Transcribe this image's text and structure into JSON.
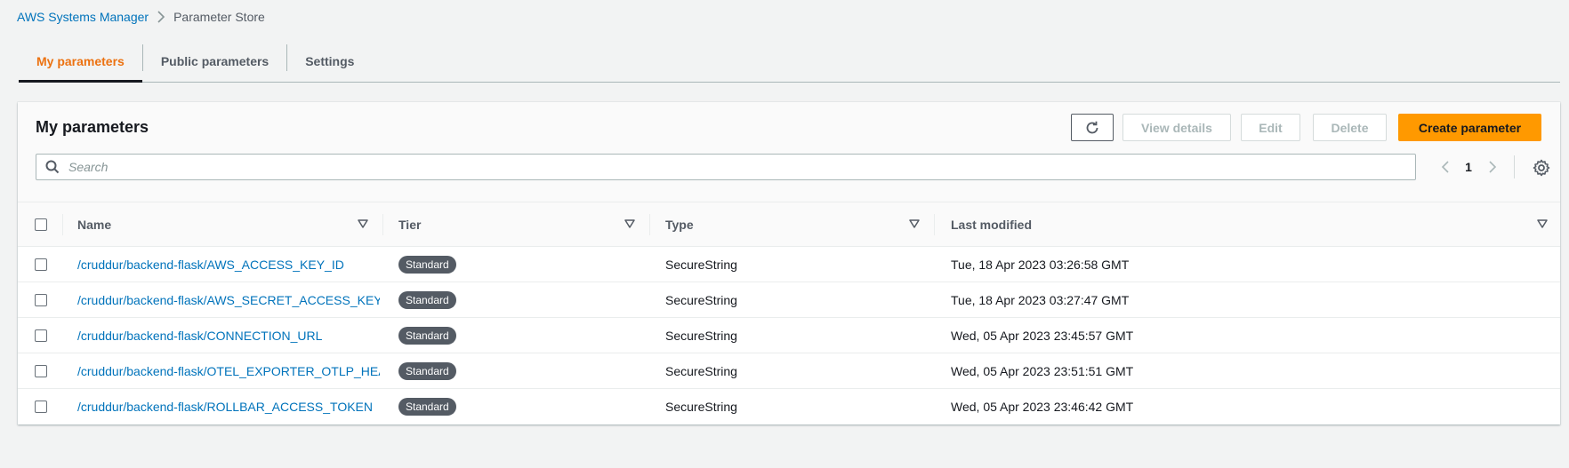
{
  "breadcrumb": {
    "root": "AWS Systems Manager",
    "current": "Parameter Store"
  },
  "tabs": [
    {
      "label": "My parameters",
      "active": true
    },
    {
      "label": "Public parameters",
      "active": false
    },
    {
      "label": "Settings",
      "active": false
    }
  ],
  "panel": {
    "title": "My parameters",
    "buttons": {
      "view_details": "View details",
      "edit": "Edit",
      "delete": "Delete",
      "create": "Create parameter"
    },
    "search_placeholder": "Search",
    "page": "1"
  },
  "table": {
    "columns": [
      "Name",
      "Tier",
      "Type",
      "Last modified"
    ],
    "rows": [
      {
        "name": "/cruddur/backend-flask/AWS_ACCESS_KEY_ID",
        "tier": "Standard",
        "type": "SecureString",
        "modified": "Tue, 18 Apr 2023 03:26:58 GMT"
      },
      {
        "name": "/cruddur/backend-flask/AWS_SECRET_ACCESS_KEY",
        "tier": "Standard",
        "type": "SecureString",
        "modified": "Tue, 18 Apr 2023 03:27:47 GMT"
      },
      {
        "name": "/cruddur/backend-flask/CONNECTION_URL",
        "tier": "Standard",
        "type": "SecureString",
        "modified": "Wed, 05 Apr 2023 23:45:57 GMT"
      },
      {
        "name": "/cruddur/backend-flask/OTEL_EXPORTER_OTLP_HEAD...",
        "tier": "Standard",
        "type": "SecureString",
        "modified": "Wed, 05 Apr 2023 23:51:51 GMT"
      },
      {
        "name": "/cruddur/backend-flask/ROLLBAR_ACCESS_TOKEN",
        "tier": "Standard",
        "type": "SecureString",
        "modified": "Wed, 05 Apr 2023 23:46:42 GMT"
      }
    ]
  },
  "colors": {
    "accent": "#ec7211",
    "primary_button": "#ff9900",
    "link": "#0073bb",
    "badge": "#545b64"
  },
  "icons": [
    "chevron-right-icon",
    "refresh-icon",
    "search-icon",
    "chevron-left-icon",
    "settings-gear-icon",
    "sort-caret-icon"
  ]
}
